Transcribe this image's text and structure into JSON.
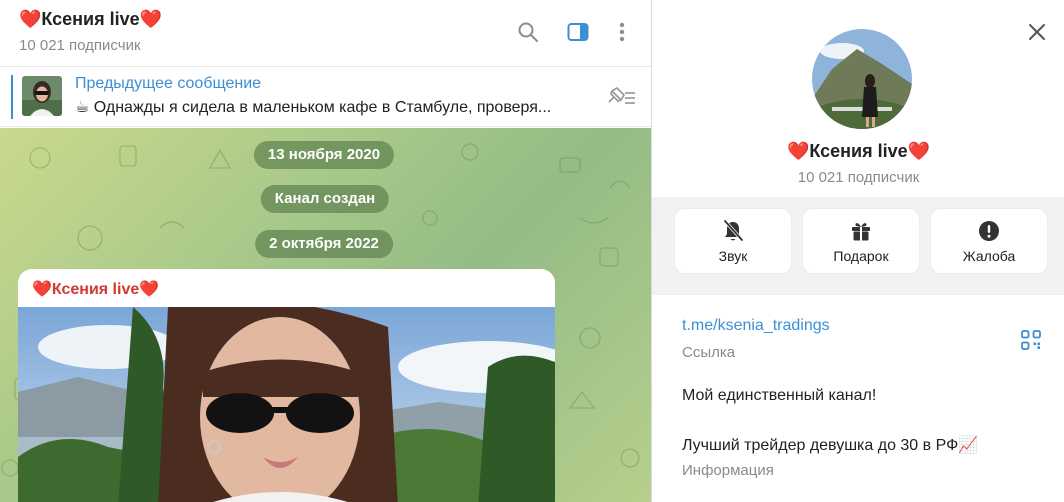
{
  "chat": {
    "title": "❤️Ксения live❤️",
    "subscribers": "10 021 подписчик"
  },
  "pinned": {
    "title": "Предыдущее сообщение",
    "text": "☕ Однажды я сидела в маленьком кафе в Стамбуле, проверя..."
  },
  "timeline": {
    "date1": "13 ноября 2020",
    "service": "Канал создан",
    "date2": "2 октября 2022"
  },
  "message": {
    "author": "❤️Ксения live❤️"
  },
  "profile": {
    "name": "❤️Ксения live❤️",
    "subscribers": "10 021 подписчик",
    "actions": [
      {
        "label": "Звук",
        "icon": "bell-off-icon"
      },
      {
        "label": "Подарок",
        "icon": "gift-icon"
      },
      {
        "label": "Жалоба",
        "icon": "report-icon"
      }
    ],
    "link": "t.me/ksenia_tradings",
    "link_caption": "Ссылка",
    "description_line1": "Мой единственный канал!",
    "description_line2": "Лучший трейдер девушка до 30 в РФ📈",
    "description_caption": "Информация"
  },
  "colors": {
    "accent": "#3a8fd6",
    "author": "#d13b2f",
    "wallpaper": "#a9c98a"
  }
}
